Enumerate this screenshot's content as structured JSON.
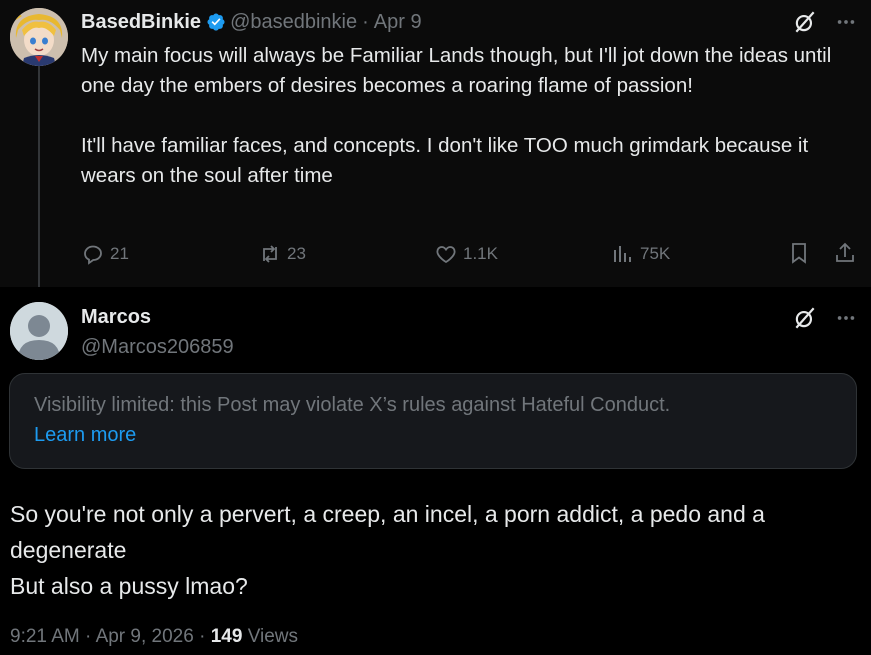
{
  "original_tweet": {
    "author_name": "BasedBinkie",
    "author_handle": "@basedbinkie",
    "separator": "·",
    "date": "Apr 9",
    "paragraph_1": "My main focus will always be Familiar Lands though, but I'll jot down the ideas until one day the embers of desires becomes a roaring flame of passion!",
    "paragraph_2": "It'll have familiar faces, and concepts. I don't like TOO much grimdark because it wears on the soul after time",
    "replies": "21",
    "reposts": "23",
    "likes": "1.1K",
    "views": "75K"
  },
  "reply": {
    "author_name": "Marcos",
    "author_handle": "@Marcos206859",
    "notice_text": "Visibility limited: this Post may violate X’s rules against Hateful Conduct.",
    "notice_link": "Learn more",
    "line_1": "So you're not only a pervert, a creep, an incel, a porn addict, a pedo and a degenerate",
    "line_2": "But also a pussy lmao?",
    "time": "9:21 AM",
    "sep1": "·",
    "date": "Apr 9, 2026",
    "sep2": "·",
    "views_count": "149",
    "views_label": "Views"
  },
  "colors": {
    "accent": "#1d9bf0",
    "muted": "#71767b",
    "text": "#e7e9ea",
    "background": "#000000"
  },
  "icons": [
    "verified-badge-icon",
    "grok-icon",
    "more-icon",
    "reply-icon",
    "repost-icon",
    "like-icon",
    "views-icon",
    "bookmark-icon",
    "share-icon",
    "default-avatar-icon"
  ]
}
